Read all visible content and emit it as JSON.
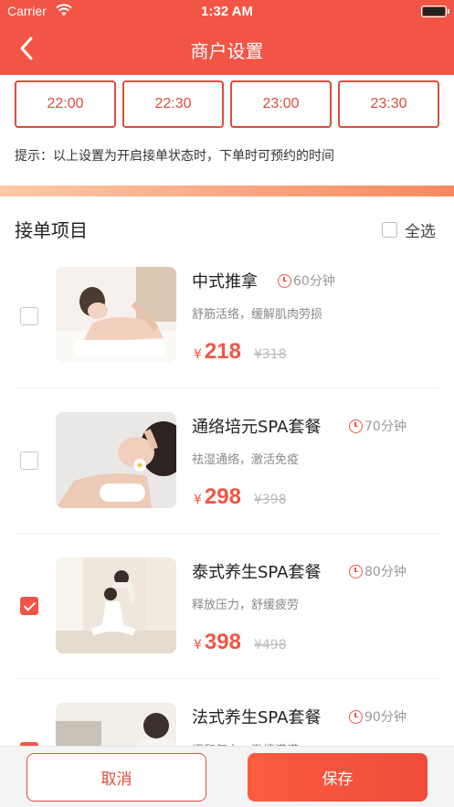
{
  "status_bar": {
    "carrier": "Carrier",
    "time": "1:32 AM"
  },
  "nav": {
    "title": "商户设置"
  },
  "time_slots": [
    "22:00",
    "22:30",
    "23:00",
    "23:30"
  ],
  "tip": "提示：以上设置为开启接单状态时，下单时可预约的时间",
  "section": {
    "title": "接单项目",
    "select_all": "全选"
  },
  "items": [
    {
      "name": "中式推拿",
      "duration": "60分钟",
      "desc": "舒筋活络，缓解肌肉劳损",
      "currency": "¥",
      "price": "218",
      "original": "¥318",
      "checked": false,
      "image": "massage-back-photo"
    },
    {
      "name": "通络培元SPA套餐",
      "duration": "70分钟",
      "desc": "祛湿通络，激活免疫",
      "currency": "¥",
      "price": "298",
      "original": "¥398",
      "checked": false,
      "image": "head-spa-photo"
    },
    {
      "name": "泰式养生SPA套餐",
      "duration": "80分钟",
      "desc": "释放压力，舒缓疲劳",
      "currency": "¥",
      "price": "398",
      "original": "¥498",
      "checked": true,
      "image": "thai-stretch-photo"
    },
    {
      "name": "法式养生SPA套餐",
      "duration": "90分钟",
      "desc": "调和气血，激情满满",
      "currency": "¥",
      "price": "",
      "original": "",
      "checked": true,
      "image": "french-spa-photo"
    }
  ],
  "buttons": {
    "cancel": "取消",
    "save": "保存"
  },
  "colors": {
    "primary": "#f25545",
    "accent_gradient_start": "#ffc9a8",
    "accent_gradient_end": "#f7895f"
  },
  "icons": {
    "back": "chevron-left-icon",
    "clock": "clock-icon",
    "wifi": "wifi-icon",
    "battery": "battery-icon"
  }
}
